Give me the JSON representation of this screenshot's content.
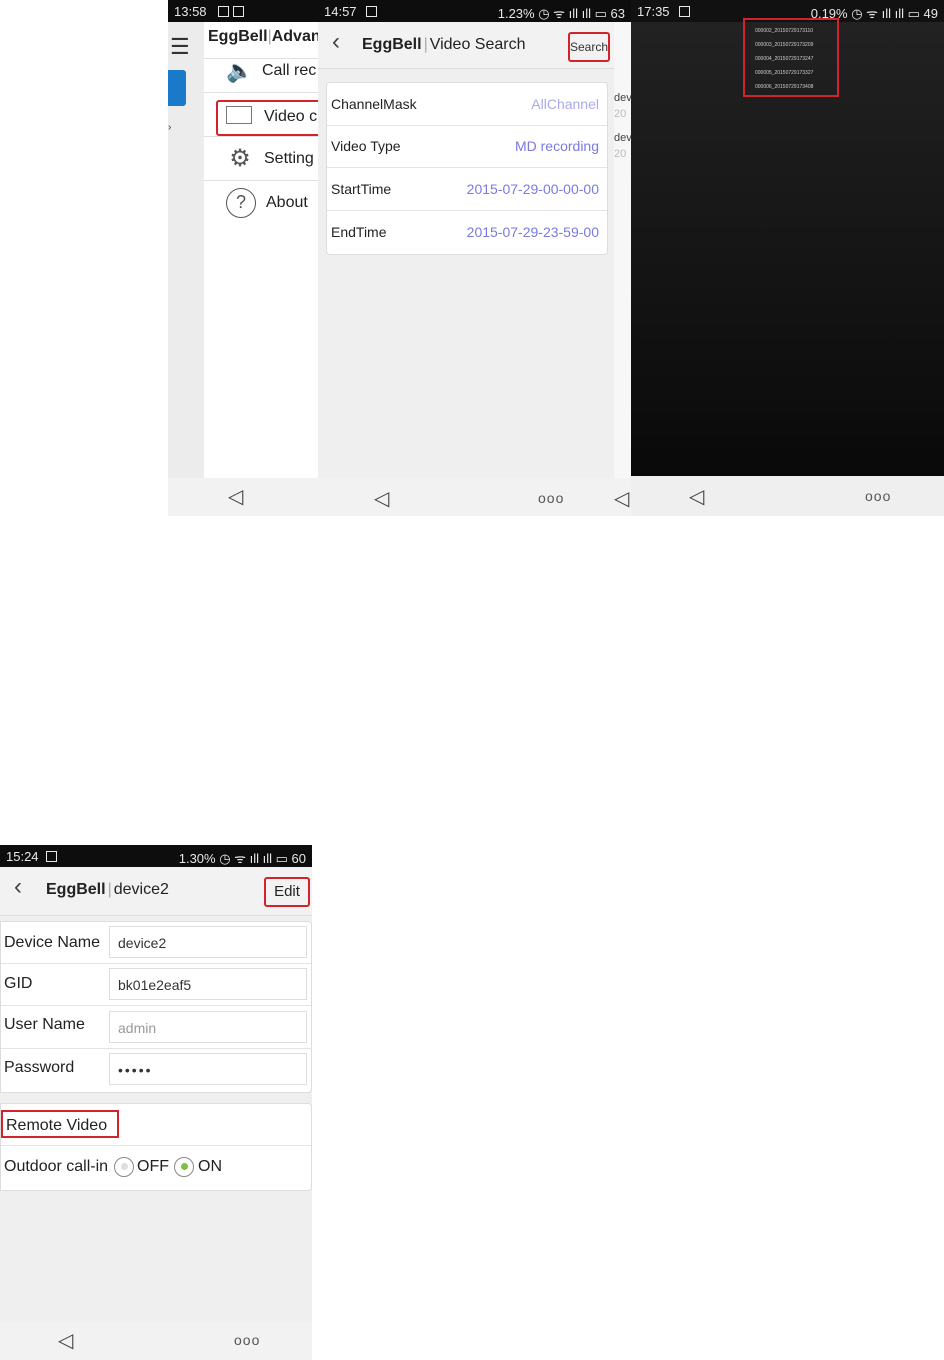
{
  "screen1": {
    "status_time": "13:58",
    "title_app": "EggBell",
    "title_rest": "Advan",
    "menu": [
      {
        "icon": "speaker-icon",
        "label": "Call rec"
      },
      {
        "icon": "video-icon",
        "label": "Video c"
      },
      {
        "icon": "gear-icon",
        "label": "Setting"
      },
      {
        "icon": "help-icon",
        "label": "About"
      }
    ]
  },
  "screen2": {
    "status_time": "14:57",
    "status_right": "1.23% ◷ ᯤ ıll ıll ▭ 63",
    "title_app": "EggBell",
    "title_page": "Video Search",
    "search_label": "Search",
    "rows": [
      {
        "key": "ChannelMask",
        "value": "AllChannel"
      },
      {
        "key": "Video Type",
        "value": "MD recording"
      },
      {
        "key": "StartTime",
        "value": "2015-07-29-00-00-00"
      },
      {
        "key": "EndTime",
        "value": "2015-07-29-23-59-00"
      }
    ],
    "peek": [
      "dev",
      "20",
      "dev",
      "20"
    ]
  },
  "screen3": {
    "status_time": "17:35",
    "status_right": "0.19% ◷ ᯤ ıll ıll ▭ 49",
    "files": [
      "000002_20150729173110",
      "000003_20150729173209",
      "000004_20150729173247",
      "000005_20150729173327",
      "000006_20150729173408"
    ]
  },
  "screen4": {
    "status_time": "15:24",
    "status_right": "1.30% ◷ ᯤ ıll ıll ▭ 60",
    "title_app": "EggBell",
    "title_page": "device2",
    "edit_label": "Edit",
    "fields": [
      {
        "label": "Device Name",
        "value": "device2"
      },
      {
        "label": "GID",
        "value": "bk01e2eaf5"
      },
      {
        "label": "User Name",
        "value": "admin"
      },
      {
        "label": "Password",
        "value": "•••••"
      }
    ],
    "remote_video_label": "Remote Video",
    "outdoor_label": "Outdoor call-in",
    "off_label": "OFF",
    "on_label": "ON"
  },
  "nav": {
    "back_glyph": "◁",
    "menu_glyph": "ooo"
  },
  "colors": {
    "highlight": "#d3232a",
    "value_text": "#7a7adf",
    "radio_on": "#7cc242"
  }
}
